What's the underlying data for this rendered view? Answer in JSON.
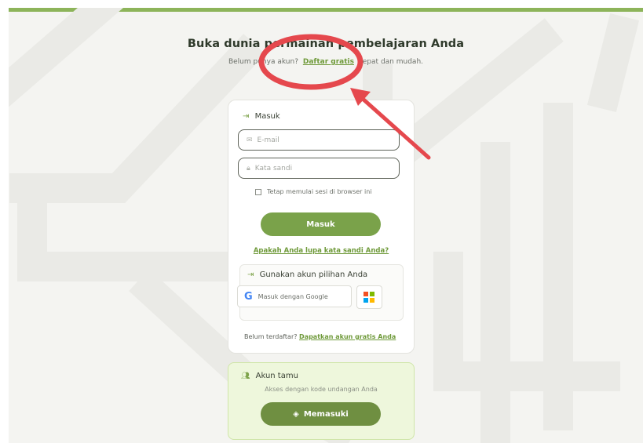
{
  "header": {
    "title": "Buka dunia permainan pembelajaran Anda",
    "subtitle_before": "Belum punya akun?",
    "signup_link": "Daftar gratis",
    "subtitle_after": "cepat dan mudah."
  },
  "login": {
    "section_title": "Masuk",
    "email_placeholder": "E-mail",
    "password_placeholder": "Kata sandi",
    "remember_label": "Tetap memulai sesi di browser ini",
    "submit_label": "Masuk",
    "forgot_link": "Apakah Anda lupa kata sandi Anda?",
    "alt_title": "Gunakan akun pilihan Anda",
    "google_label": "Masuk dengan Google",
    "register_text": "Belum terdaftar?",
    "register_link": "Dapatkan akun gratis Anda"
  },
  "guest": {
    "title": "Akun tamu",
    "subtitle": "Akses dengan kode undangan Anda",
    "button_label": "Memasuki"
  },
  "colors": {
    "accent": "#7aa24a",
    "annotation": "#e5484d"
  },
  "icons": {
    "login": "sign-in-icon",
    "email": "mail-icon",
    "password": "lock-icon",
    "google": "google-icon",
    "microsoft": "microsoft-icon",
    "guest": "users-icon",
    "enter": "diamond-arrow-icon"
  }
}
